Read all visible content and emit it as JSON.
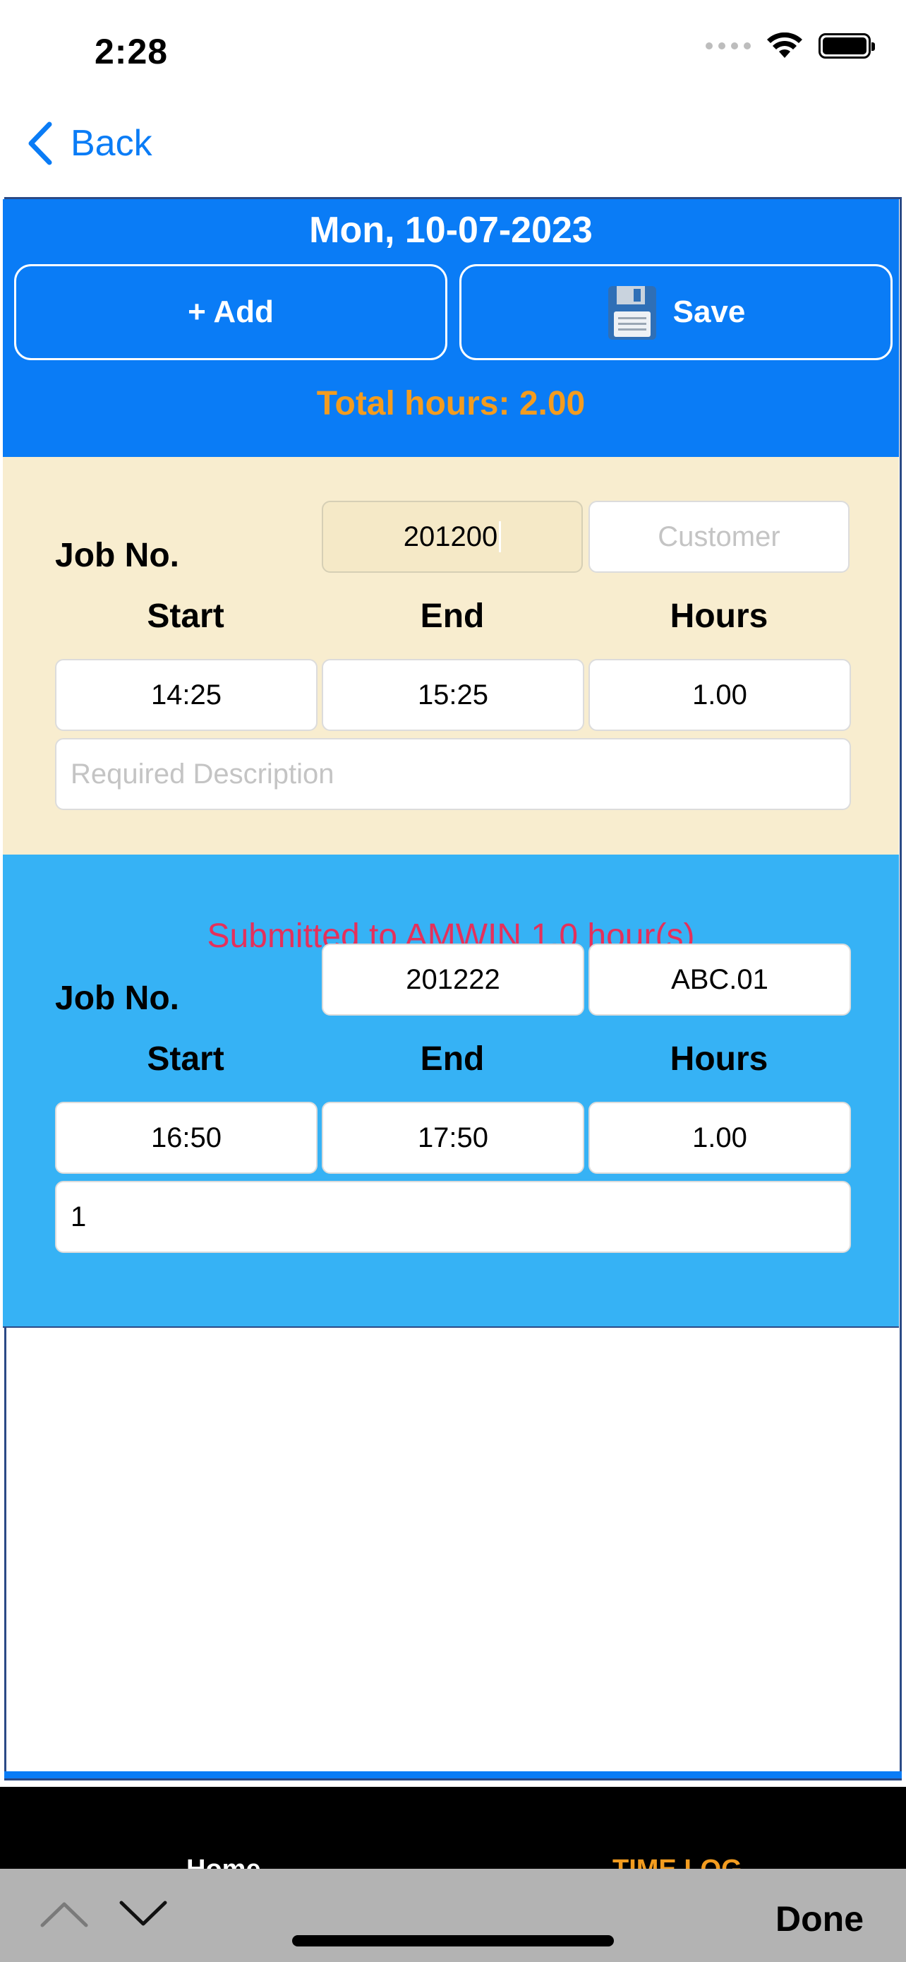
{
  "status_bar": {
    "time": "2:28",
    "icons": [
      "cellular-signal-icon",
      "wifi-icon",
      "battery-icon"
    ]
  },
  "nav": {
    "back_label": "Back",
    "back_icon": "chevron-left-icon"
  },
  "header": {
    "date": "Mon, 10-07-2023",
    "add_label": "+ Add",
    "save_label": "Save",
    "save_icon": "floppy-disk-icon",
    "total_hours": "Total hours: 2.00"
  },
  "entries": [
    {
      "job_label": "Job No.",
      "job_no": "201200",
      "customer_placeholder": "Customer",
      "start_label": "Start",
      "end_label": "End",
      "hours_label": "Hours",
      "start": "14:25",
      "end": "15:25",
      "hours": "1.00",
      "description_placeholder": "Required Description"
    },
    {
      "submitted_text": "Submitted to AMWIN 1.0 hour(s)",
      "job_label": "Job No.",
      "job_no": "201222",
      "customer": "ABC.01",
      "start_label": "Start",
      "end_label": "End",
      "hours_label": "Hours",
      "start": "16:50",
      "end": "17:50",
      "hours": "1.00",
      "description": "1"
    }
  ],
  "tab_bar": {
    "home_label": "Home",
    "timelog_label": "TIME LOG"
  },
  "keyboard_toolbar": {
    "done_label": "Done"
  },
  "colors": {
    "header_blue": "#0a7cf6",
    "entry_editing_bg": "#f8edcf",
    "entry_submitted_bg": "#36b2f5",
    "total_orange": "#f39c1f",
    "submitted_red": "#e5305b"
  }
}
